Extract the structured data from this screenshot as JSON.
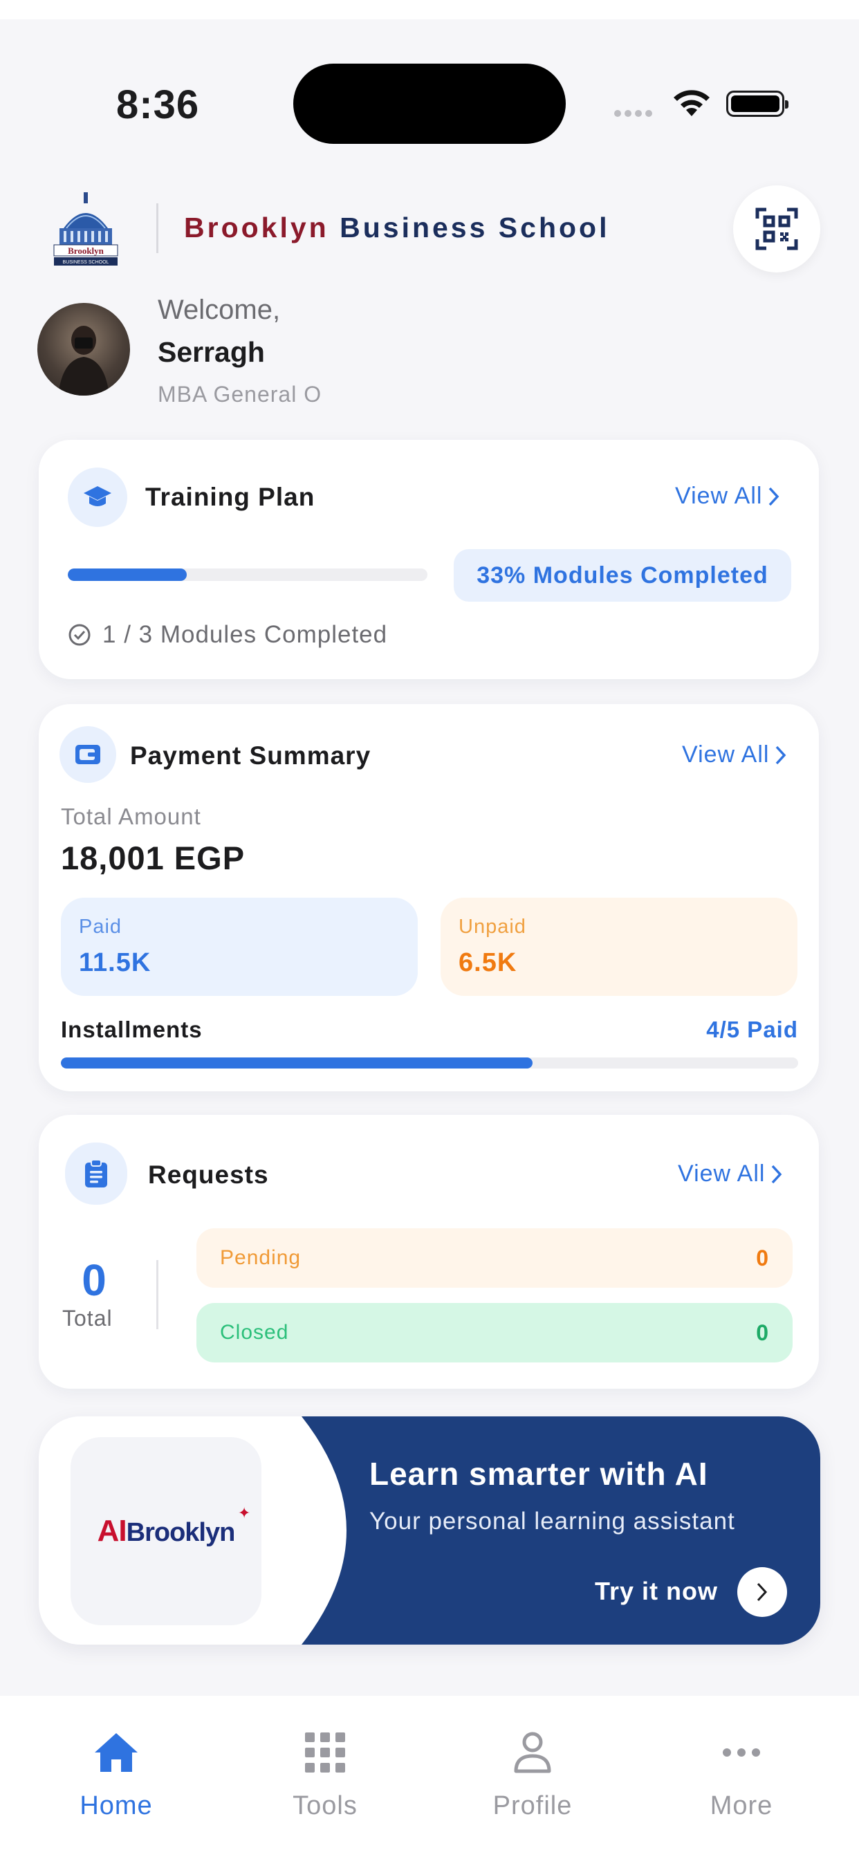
{
  "status_bar": {
    "time": "8:36"
  },
  "header": {
    "school_name_part1": "Brooklyn",
    "school_name_part2": "Business School",
    "logo_text": "Brooklyn",
    "logo_subtext": "BUSINESS SCHOOL"
  },
  "user": {
    "welcome": "Welcome,",
    "name": "Serragh",
    "program": "MBA General O"
  },
  "training_plan": {
    "title": "Training Plan",
    "view_all": "View All",
    "progress_fraction": 0.33,
    "progress_badge": "33% Modules Completed",
    "modules_completed": "1 / 3 Modules Completed"
  },
  "payment_summary": {
    "title": "Payment Summary",
    "view_all": "View All",
    "total_label": "Total Amount",
    "total_amount": "18,001 EGP",
    "paid_label": "Paid",
    "paid_value": "11.5K",
    "unpaid_label": "Unpaid",
    "unpaid_value": "6.5K",
    "installments_label": "Installments",
    "installments_paid": "4/5 Paid",
    "installments_fraction": 0.64
  },
  "requests": {
    "title": "Requests",
    "view_all": "View All",
    "total_value": "0",
    "total_label": "Total",
    "pending_label": "Pending",
    "pending_count": "0",
    "closed_label": "Closed",
    "closed_count": "0"
  },
  "ai_banner": {
    "logo_ai": "AI",
    "logo_brand": "Brooklyn",
    "title": "Learn smarter with AI",
    "subtitle": "Your personal learning assistant",
    "cta": "Try it now"
  },
  "tabbar": {
    "items": [
      {
        "label": "Home",
        "icon": "home-icon",
        "active": true
      },
      {
        "label": "Tools",
        "icon": "grid-icon",
        "active": false
      },
      {
        "label": "Profile",
        "icon": "person-icon",
        "active": false
      },
      {
        "label": "More",
        "icon": "more-icon",
        "active": false
      }
    ]
  },
  "colors": {
    "accent": "#2f73e0",
    "brand_red": "#8b1a2b",
    "brand_navy": "#1b2e5c",
    "banner_blue": "#1d3f7e",
    "pending": "#f07a10",
    "closed": "#1daa66"
  }
}
